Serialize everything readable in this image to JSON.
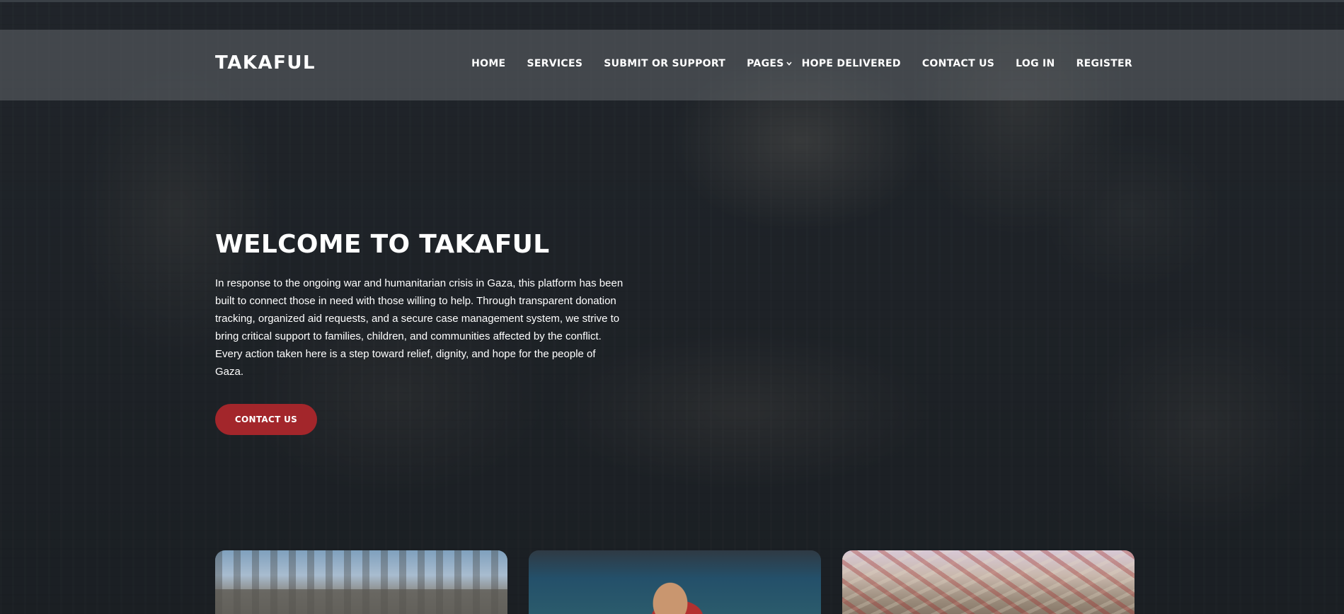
{
  "header": {
    "brand": "TAKAFUL",
    "nav": {
      "home": "HOME",
      "services": "SERVICES",
      "submit_or_support": "SUBMIT OR SUPPORT",
      "pages": "PAGES",
      "hope_delivered": "HOPE DELIVERED",
      "contact_us": "CONTACT US",
      "log_in": "LOG IN",
      "register": "REGISTER"
    },
    "pages_dropdown_icon": "chevron-down-icon"
  },
  "hero": {
    "title": "WELCOME TO TAKAFUL",
    "description": "In response to the ongoing war and humanitarian crisis in Gaza, this platform has been built to connect those in need with those willing to help. Through transparent donation tracking, organized aid requests, and a secure case management system, we strive to bring critical support to families, children, and communities affected by the conflict. Every action taken here is a step toward relief, dignity, and hope for the people of Gaza.",
    "cta_label": "CONTACT US"
  },
  "colors": {
    "accent": "#a3262b",
    "navbar_bg": "rgba(110,115,120,0.45)",
    "hero_overlay": "#181c20"
  }
}
